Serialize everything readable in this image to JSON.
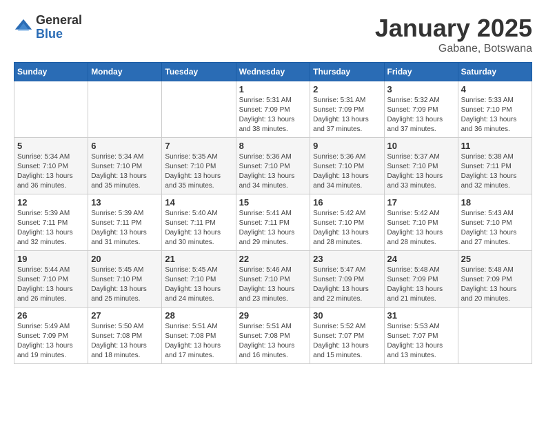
{
  "logo": {
    "general": "General",
    "blue": "Blue"
  },
  "header": {
    "month": "January 2025",
    "location": "Gabane, Botswana"
  },
  "weekdays": [
    "Sunday",
    "Monday",
    "Tuesday",
    "Wednesday",
    "Thursday",
    "Friday",
    "Saturday"
  ],
  "weeks": [
    [
      {
        "day": "",
        "sunrise": "",
        "sunset": "",
        "daylight": ""
      },
      {
        "day": "",
        "sunrise": "",
        "sunset": "",
        "daylight": ""
      },
      {
        "day": "",
        "sunrise": "",
        "sunset": "",
        "daylight": ""
      },
      {
        "day": "1",
        "sunrise": "Sunrise: 5:31 AM",
        "sunset": "Sunset: 7:09 PM",
        "daylight": "Daylight: 13 hours and 38 minutes."
      },
      {
        "day": "2",
        "sunrise": "Sunrise: 5:31 AM",
        "sunset": "Sunset: 7:09 PM",
        "daylight": "Daylight: 13 hours and 37 minutes."
      },
      {
        "day": "3",
        "sunrise": "Sunrise: 5:32 AM",
        "sunset": "Sunset: 7:09 PM",
        "daylight": "Daylight: 13 hours and 37 minutes."
      },
      {
        "day": "4",
        "sunrise": "Sunrise: 5:33 AM",
        "sunset": "Sunset: 7:10 PM",
        "daylight": "Daylight: 13 hours and 36 minutes."
      }
    ],
    [
      {
        "day": "5",
        "sunrise": "Sunrise: 5:34 AM",
        "sunset": "Sunset: 7:10 PM",
        "daylight": "Daylight: 13 hours and 36 minutes."
      },
      {
        "day": "6",
        "sunrise": "Sunrise: 5:34 AM",
        "sunset": "Sunset: 7:10 PM",
        "daylight": "Daylight: 13 hours and 35 minutes."
      },
      {
        "day": "7",
        "sunrise": "Sunrise: 5:35 AM",
        "sunset": "Sunset: 7:10 PM",
        "daylight": "Daylight: 13 hours and 35 minutes."
      },
      {
        "day": "8",
        "sunrise": "Sunrise: 5:36 AM",
        "sunset": "Sunset: 7:10 PM",
        "daylight": "Daylight: 13 hours and 34 minutes."
      },
      {
        "day": "9",
        "sunrise": "Sunrise: 5:36 AM",
        "sunset": "Sunset: 7:10 PM",
        "daylight": "Daylight: 13 hours and 34 minutes."
      },
      {
        "day": "10",
        "sunrise": "Sunrise: 5:37 AM",
        "sunset": "Sunset: 7:10 PM",
        "daylight": "Daylight: 13 hours and 33 minutes."
      },
      {
        "day": "11",
        "sunrise": "Sunrise: 5:38 AM",
        "sunset": "Sunset: 7:11 PM",
        "daylight": "Daylight: 13 hours and 32 minutes."
      }
    ],
    [
      {
        "day": "12",
        "sunrise": "Sunrise: 5:39 AM",
        "sunset": "Sunset: 7:11 PM",
        "daylight": "Daylight: 13 hours and 32 minutes."
      },
      {
        "day": "13",
        "sunrise": "Sunrise: 5:39 AM",
        "sunset": "Sunset: 7:11 PM",
        "daylight": "Daylight: 13 hours and 31 minutes."
      },
      {
        "day": "14",
        "sunrise": "Sunrise: 5:40 AM",
        "sunset": "Sunset: 7:11 PM",
        "daylight": "Daylight: 13 hours and 30 minutes."
      },
      {
        "day": "15",
        "sunrise": "Sunrise: 5:41 AM",
        "sunset": "Sunset: 7:11 PM",
        "daylight": "Daylight: 13 hours and 29 minutes."
      },
      {
        "day": "16",
        "sunrise": "Sunrise: 5:42 AM",
        "sunset": "Sunset: 7:10 PM",
        "daylight": "Daylight: 13 hours and 28 minutes."
      },
      {
        "day": "17",
        "sunrise": "Sunrise: 5:42 AM",
        "sunset": "Sunset: 7:10 PM",
        "daylight": "Daylight: 13 hours and 28 minutes."
      },
      {
        "day": "18",
        "sunrise": "Sunrise: 5:43 AM",
        "sunset": "Sunset: 7:10 PM",
        "daylight": "Daylight: 13 hours and 27 minutes."
      }
    ],
    [
      {
        "day": "19",
        "sunrise": "Sunrise: 5:44 AM",
        "sunset": "Sunset: 7:10 PM",
        "daylight": "Daylight: 13 hours and 26 minutes."
      },
      {
        "day": "20",
        "sunrise": "Sunrise: 5:45 AM",
        "sunset": "Sunset: 7:10 PM",
        "daylight": "Daylight: 13 hours and 25 minutes."
      },
      {
        "day": "21",
        "sunrise": "Sunrise: 5:45 AM",
        "sunset": "Sunset: 7:10 PM",
        "daylight": "Daylight: 13 hours and 24 minutes."
      },
      {
        "day": "22",
        "sunrise": "Sunrise: 5:46 AM",
        "sunset": "Sunset: 7:10 PM",
        "daylight": "Daylight: 13 hours and 23 minutes."
      },
      {
        "day": "23",
        "sunrise": "Sunrise: 5:47 AM",
        "sunset": "Sunset: 7:09 PM",
        "daylight": "Daylight: 13 hours and 22 minutes."
      },
      {
        "day": "24",
        "sunrise": "Sunrise: 5:48 AM",
        "sunset": "Sunset: 7:09 PM",
        "daylight": "Daylight: 13 hours and 21 minutes."
      },
      {
        "day": "25",
        "sunrise": "Sunrise: 5:48 AM",
        "sunset": "Sunset: 7:09 PM",
        "daylight": "Daylight: 13 hours and 20 minutes."
      }
    ],
    [
      {
        "day": "26",
        "sunrise": "Sunrise: 5:49 AM",
        "sunset": "Sunset: 7:09 PM",
        "daylight": "Daylight: 13 hours and 19 minutes."
      },
      {
        "day": "27",
        "sunrise": "Sunrise: 5:50 AM",
        "sunset": "Sunset: 7:08 PM",
        "daylight": "Daylight: 13 hours and 18 minutes."
      },
      {
        "day": "28",
        "sunrise": "Sunrise: 5:51 AM",
        "sunset": "Sunset: 7:08 PM",
        "daylight": "Daylight: 13 hours and 17 minutes."
      },
      {
        "day": "29",
        "sunrise": "Sunrise: 5:51 AM",
        "sunset": "Sunset: 7:08 PM",
        "daylight": "Daylight: 13 hours and 16 minutes."
      },
      {
        "day": "30",
        "sunrise": "Sunrise: 5:52 AM",
        "sunset": "Sunset: 7:07 PM",
        "daylight": "Daylight: 13 hours and 15 minutes."
      },
      {
        "day": "31",
        "sunrise": "Sunrise: 5:53 AM",
        "sunset": "Sunset: 7:07 PM",
        "daylight": "Daylight: 13 hours and 13 minutes."
      },
      {
        "day": "",
        "sunrise": "",
        "sunset": "",
        "daylight": ""
      }
    ]
  ]
}
